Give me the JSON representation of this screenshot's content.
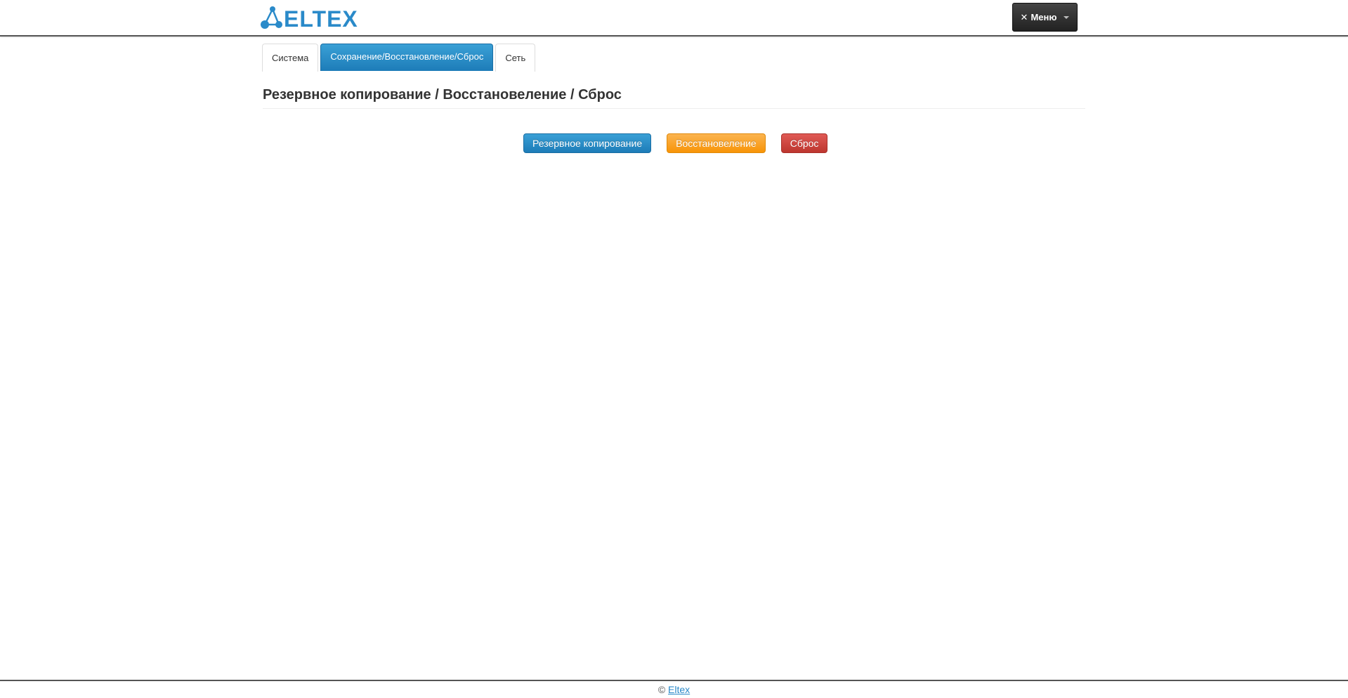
{
  "header": {
    "logo_text": "ELTEX",
    "menu_label": "Меню"
  },
  "tabs": [
    {
      "label": "Система",
      "active": false
    },
    {
      "label": "Сохранение/Восстановление/Сброс",
      "active": true
    },
    {
      "label": "Сеть",
      "active": false
    }
  ],
  "main": {
    "title": "Резервное копирование / Восстановеление / Сброс",
    "buttons": {
      "backup": "Резервное копирование",
      "restore": "Восстановеление",
      "reset": "Сброс"
    }
  },
  "footer": {
    "copyright": "©",
    "link": "Eltex"
  },
  "colors": {
    "accent_blue": "#1d7cb8",
    "warning_orange": "#f89406",
    "danger_red": "#bd362f",
    "logo_blue": "#2a8ac9"
  }
}
